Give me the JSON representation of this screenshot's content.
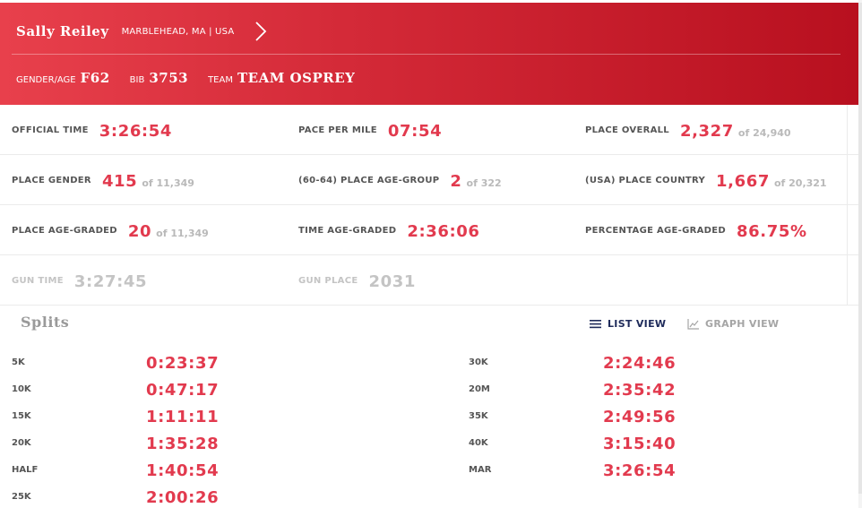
{
  "runner": {
    "name": "Sally Reiley",
    "location": "MARBLEHEAD, MA | USA",
    "gender_age_label": "GENDER/AGE",
    "gender_age": "F62",
    "bib_label": "BIB",
    "bib": "3753",
    "team_label": "TEAM",
    "team": "TEAM OSPREY"
  },
  "stats": {
    "rows": [
      [
        {
          "label": "OFFICIAL TIME",
          "value": "3:26:54",
          "of": ""
        },
        {
          "label": "PACE PER MILE",
          "value": "07:54",
          "of": ""
        },
        {
          "label": "PLACE OVERALL",
          "value": "2,327",
          "of": "of 24,940"
        }
      ],
      [
        {
          "label": "PLACE GENDER",
          "value": "415",
          "of": "of 11,349"
        },
        {
          "label": "(60-64) PLACE AGE-GROUP",
          "value": "2",
          "of": "of 322"
        },
        {
          "label": "(USA) PLACE COUNTRY",
          "value": "1,667",
          "of": "of 20,321"
        }
      ],
      [
        {
          "label": "PLACE AGE-GRADED",
          "value": "20",
          "of": "of 11,349"
        },
        {
          "label": "TIME AGE-GRADED",
          "value": "2:36:06",
          "of": ""
        },
        {
          "label": "PERCENTAGE AGE-GRADED",
          "value": "86.75%",
          "of": ""
        }
      ],
      [
        {
          "label": "GUN TIME",
          "value": "3:27:45",
          "of": ""
        },
        {
          "label": "GUN PLACE",
          "value": "2031",
          "of": ""
        },
        {
          "label": "",
          "value": "",
          "of": ""
        }
      ]
    ]
  },
  "splits": {
    "title": "Splits",
    "list_view_label": "LIST VIEW",
    "graph_view_label": "GRAPH VIEW",
    "left": [
      {
        "label": "5K",
        "time": "0:23:37"
      },
      {
        "label": "10K",
        "time": "0:47:17"
      },
      {
        "label": "15K",
        "time": "1:11:11"
      },
      {
        "label": "20K",
        "time": "1:35:28"
      },
      {
        "label": "HALF",
        "time": "1:40:54"
      },
      {
        "label": "25K",
        "time": "2:00:26"
      }
    ],
    "right": [
      {
        "label": "30K",
        "time": "2:24:46"
      },
      {
        "label": "20M",
        "time": "2:35:42"
      },
      {
        "label": "35K",
        "time": "2:49:56"
      },
      {
        "label": "40K",
        "time": "3:15:40"
      },
      {
        "label": "MAR",
        "time": "3:26:54"
      }
    ]
  },
  "icons": {
    "runner_arrow": "chevron-right-icon",
    "list_view": "list-icon",
    "graph_view": "line-chart-icon"
  },
  "colors": {
    "header_start": "#e8404c",
    "header_end": "#b8101f",
    "accent": "#e23a4e",
    "active_view": "#1e2a5a",
    "muted": "#c4c4c4"
  }
}
